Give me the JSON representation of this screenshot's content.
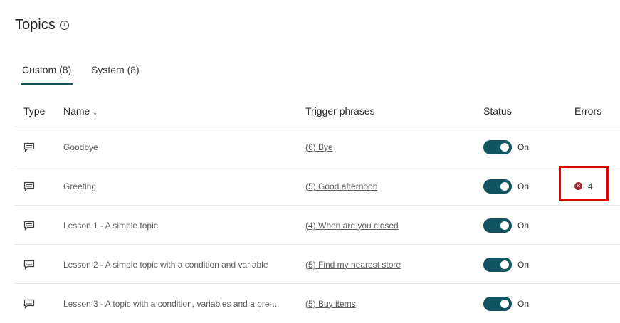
{
  "page": {
    "title": "Topics",
    "info_icon": "info-icon"
  },
  "tabs": [
    {
      "label": "Custom (8)",
      "active": true
    },
    {
      "label": "System (8)",
      "active": false
    }
  ],
  "table": {
    "columns": {
      "type": "Type",
      "name": "Name ↓",
      "trigger": "Trigger phrases",
      "status": "Status",
      "errors": "Errors"
    },
    "rows": [
      {
        "icon": "chat-message-icon",
        "name": "Goodbye",
        "trigger": "(6) Bye",
        "status_on": true,
        "status_label": "On",
        "errors": ""
      },
      {
        "icon": "chat-message-icon",
        "name": "Greeting",
        "trigger": "(5) Good afternoon",
        "status_on": true,
        "status_label": "On",
        "errors": "4"
      },
      {
        "icon": "chat-message-icon",
        "name": "Lesson 1 - A simple topic",
        "trigger": "(4) When are you closed",
        "status_on": true,
        "status_label": "On",
        "errors": ""
      },
      {
        "icon": "chat-message-icon",
        "name": "Lesson 2 - A simple topic with a condition and variable",
        "trigger": "(5) Find my nearest store",
        "status_on": true,
        "status_label": "On",
        "errors": ""
      },
      {
        "icon": "chat-message-icon",
        "name": "Lesson 3 - A topic with a condition, variables and a pre-...",
        "trigger": "(5) Buy items",
        "status_on": true,
        "status_label": "On",
        "errors": ""
      }
    ]
  },
  "colors": {
    "accent": "#115461",
    "error_icon": "#a4262c",
    "highlight_box": "#e50000"
  }
}
